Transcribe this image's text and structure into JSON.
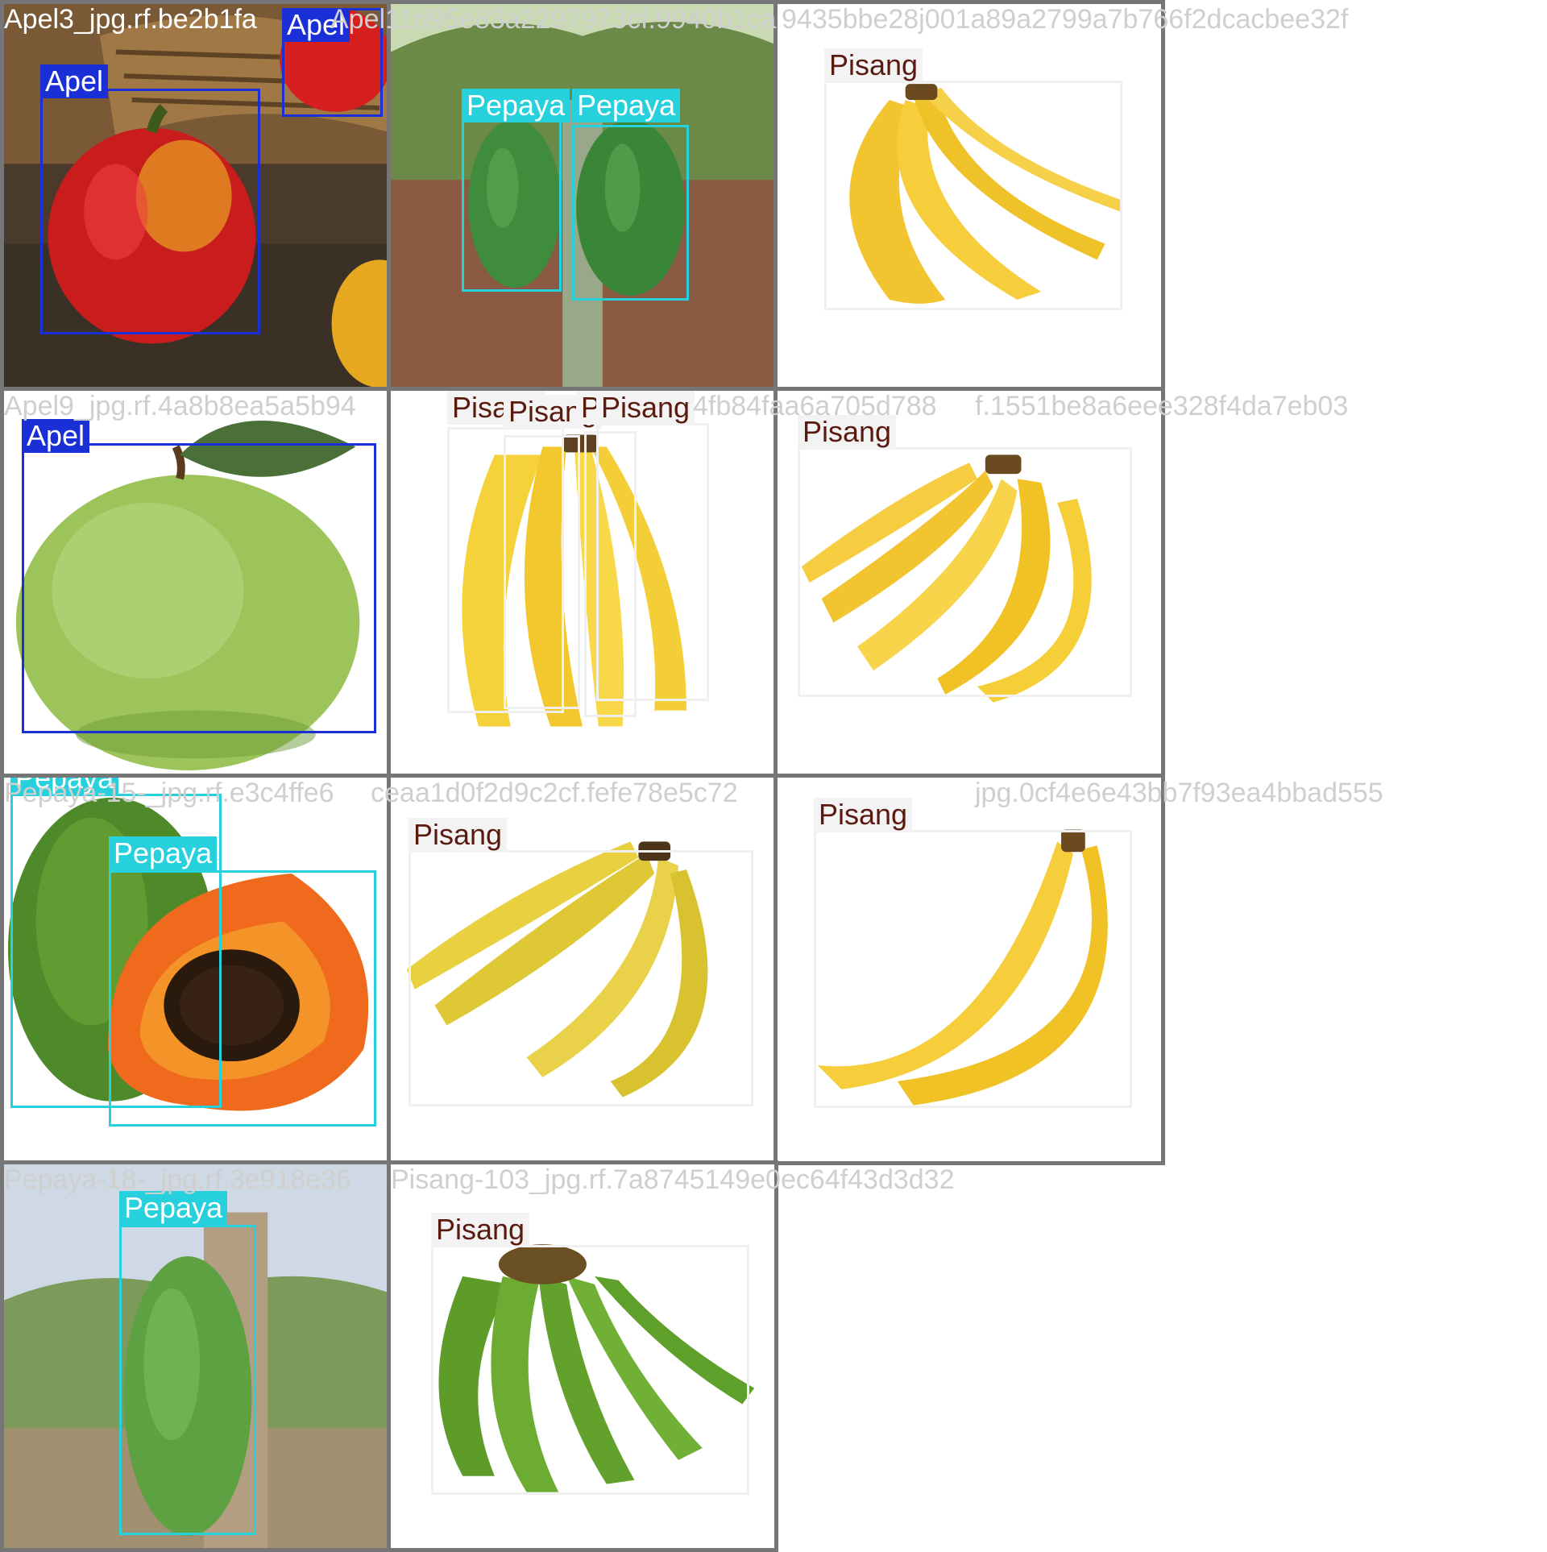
{
  "labels": {
    "apel": "Apel",
    "pepaya": "Pepaya",
    "pisang": "Pisang"
  },
  "colors": {
    "apel": "#1a2fd6",
    "pepaya": "#26d0dc",
    "pisang": "#f0f0f0",
    "tile_border": "#767676"
  },
  "filenames": {
    "r1c1": "Apel3_jpg.rf.be2b1fa",
    "r1c2": "Apel11d95e83a2297973cf.9940b1ca",
    "r1c3": "9435bbe28j001a89a2799a7b766f2dcacbee32f",
    "r2c1": "Apel9_jpg.rf.4a8b8ea5a5b94",
    "r2c2": "4fb84faa6a705d788",
    "r2c3": "f.1551be8a6eee328f4da7eb03",
    "r3c1": "Pepaya-15-_jpg.rf.e3c4ffe6",
    "r3c2": "ceaa1d0f2d9c2cf.fefe78e5c72",
    "r3c3": "jpg.0cf4e6e43bb7f93ea4bbad555",
    "r4c1": "Pepaya-18-_jpg.rf.3e918e36",
    "r4c2": "Pisang-103_jpg.rf.7a8745149e0ec64f43d3d32"
  }
}
